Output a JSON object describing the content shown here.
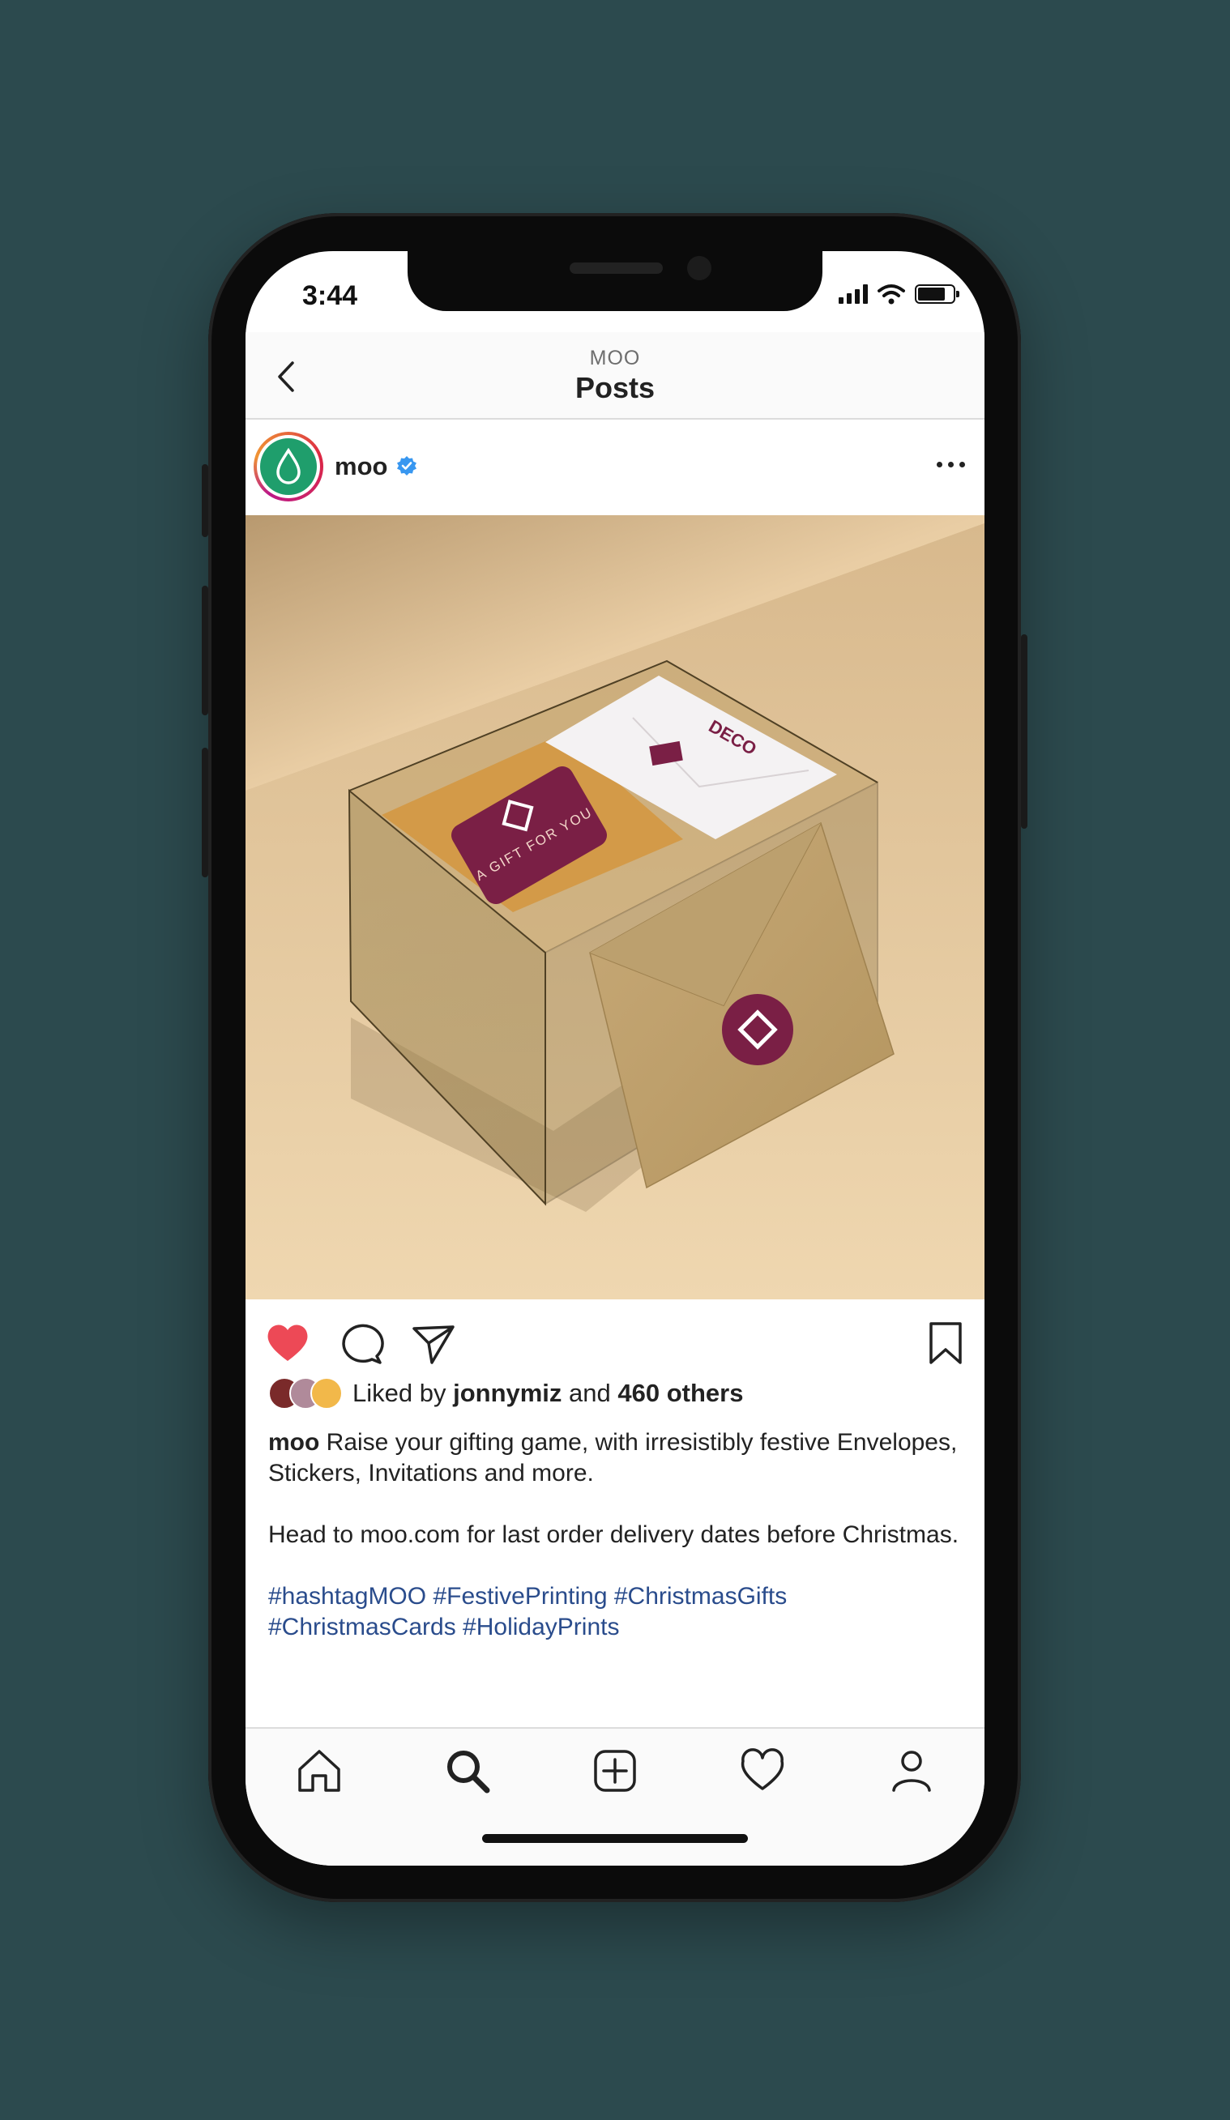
{
  "status_bar": {
    "time": "3:44"
  },
  "header": {
    "subtitle": "MOO",
    "title": "Posts"
  },
  "post": {
    "username": "moo",
    "verified": true,
    "liked_by_prefix": "Liked by ",
    "liked_by_user": "jonnymiz",
    "liked_by_mid": " and ",
    "liked_by_others": "460 others",
    "caption_user": "moo",
    "caption_line1": " Raise your gifting game, with irresistibly festive Envelopes, Stickers, Invitations and more.",
    "caption_line2": "Head to moo.com for last order delivery dates before Christmas.",
    "hashtags": "#hashtagMOO #FestivePrinting #ChristmasGifts #ChristmasCards #HolidayPrints",
    "liked": true
  },
  "photo": {
    "card_left_text": "A GIFT FOR YOU",
    "card_right_text": "DECO"
  },
  "icons": [
    "back-icon",
    "verified-icon",
    "more-icon",
    "heart-icon",
    "comment-icon",
    "share-icon",
    "bookmark-icon",
    "home-icon",
    "search-icon",
    "add-icon",
    "activity-icon",
    "profile-icon"
  ],
  "colors": {
    "background": "#2c4a4e",
    "like_red": "#ed4956",
    "hashtag_blue": "#2a4c8c",
    "brand_green": "#1f9e6c",
    "sticker_maroon": "#7a1f45"
  }
}
